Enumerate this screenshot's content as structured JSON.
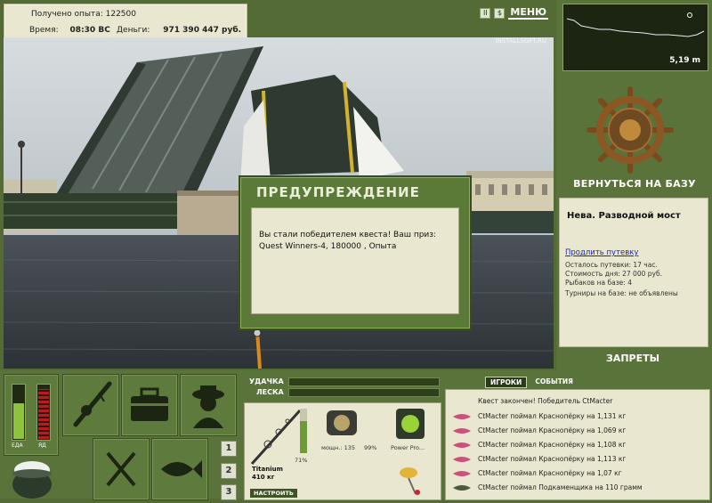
{
  "top_left": {
    "xp_label": "Получено опыта:",
    "xp_value": "122500",
    "time_label": "Время:",
    "time_value": "08:30 ВС",
    "money_label": "Деньги:",
    "money_value": "971 390 447 руб."
  },
  "top_buttons": {
    "pause": "II",
    "sound": "$",
    "menu": "МЕНЮ"
  },
  "watermark": "INSTALLSOFT.RU",
  "depth": {
    "value": "5,19 m"
  },
  "base": {
    "return_label": "ВЕРНУТЬСЯ НА БАЗУ",
    "location": "Нева. Разводной мост",
    "extend_link": "Продлить путевку",
    "remaining": "Осталось путевки: 17 час.",
    "day_cost": "Стоимость дня: 27 000 руб.",
    "anglers": "Рыбаков на базе: 4",
    "tournaments": "Турниры на базе: не объявлены",
    "bans_label": "ЗАПРЕТЫ"
  },
  "dialog": {
    "title": "ПРЕДУПРЕЖДЕНИЕ",
    "message": "Вы стали победителем квеста! Ваш приз: Quest Winners-4, 180000 , Опыта"
  },
  "meters": {
    "food_label": "ЕДА",
    "poison_label": "ЯД"
  },
  "bars": {
    "luck_label": "УДАЧКА",
    "line_label": "ЛЕСКА"
  },
  "tackle": {
    "rod_name": "Titanium",
    "rod_weight": "410 кг",
    "rod_percent": "71%",
    "tune_button": "НАСТРОИТЬ",
    "reel_power": "мощн.: 135",
    "reel_percent": "99%",
    "lure_name": "Power Pro..."
  },
  "slot_numbers": [
    "1",
    "2",
    "3"
  ],
  "feed": {
    "tab_players": "ИГРОКИ",
    "tab_events": "СОБЫТИЯ",
    "header": "Квест закончен! Победитель CtMacter",
    "rows": [
      "CtMacter поймал Краснопёрку на 1,131 кг",
      "CtMacter поймал Краснопёрку на 1,069 кг",
      "CtMacter поймал Краснопёрку на 1,108 кг",
      "CtMacter поймал Краснопёрку на 1,113 кг",
      "CtMacter поймал Краснопёрку на 1,07 кг",
      "CtMacter поймал Подкаменщика на 110 грамм"
    ]
  },
  "colors": {
    "panel": "#59733a",
    "panel_dark": "#3a4d21",
    "paper": "#e9e7cf",
    "link": "#1a2bb5"
  }
}
